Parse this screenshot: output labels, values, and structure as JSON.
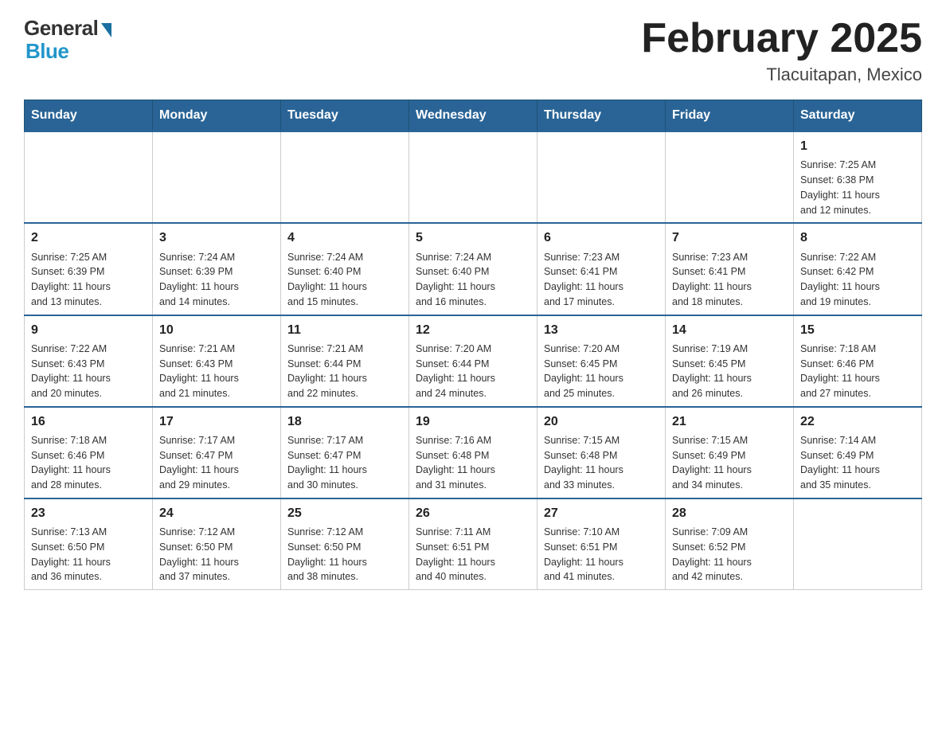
{
  "header": {
    "logo_general": "General",
    "logo_blue": "Blue",
    "month_title": "February 2025",
    "location": "Tlacuitapan, Mexico"
  },
  "days_of_week": [
    "Sunday",
    "Monday",
    "Tuesday",
    "Wednesday",
    "Thursday",
    "Friday",
    "Saturday"
  ],
  "weeks": [
    [
      {
        "day": "",
        "info": ""
      },
      {
        "day": "",
        "info": ""
      },
      {
        "day": "",
        "info": ""
      },
      {
        "day": "",
        "info": ""
      },
      {
        "day": "",
        "info": ""
      },
      {
        "day": "",
        "info": ""
      },
      {
        "day": "1",
        "info": "Sunrise: 7:25 AM\nSunset: 6:38 PM\nDaylight: 11 hours\nand 12 minutes."
      }
    ],
    [
      {
        "day": "2",
        "info": "Sunrise: 7:25 AM\nSunset: 6:39 PM\nDaylight: 11 hours\nand 13 minutes."
      },
      {
        "day": "3",
        "info": "Sunrise: 7:24 AM\nSunset: 6:39 PM\nDaylight: 11 hours\nand 14 minutes."
      },
      {
        "day": "4",
        "info": "Sunrise: 7:24 AM\nSunset: 6:40 PM\nDaylight: 11 hours\nand 15 minutes."
      },
      {
        "day": "5",
        "info": "Sunrise: 7:24 AM\nSunset: 6:40 PM\nDaylight: 11 hours\nand 16 minutes."
      },
      {
        "day": "6",
        "info": "Sunrise: 7:23 AM\nSunset: 6:41 PM\nDaylight: 11 hours\nand 17 minutes."
      },
      {
        "day": "7",
        "info": "Sunrise: 7:23 AM\nSunset: 6:41 PM\nDaylight: 11 hours\nand 18 minutes."
      },
      {
        "day": "8",
        "info": "Sunrise: 7:22 AM\nSunset: 6:42 PM\nDaylight: 11 hours\nand 19 minutes."
      }
    ],
    [
      {
        "day": "9",
        "info": "Sunrise: 7:22 AM\nSunset: 6:43 PM\nDaylight: 11 hours\nand 20 minutes."
      },
      {
        "day": "10",
        "info": "Sunrise: 7:21 AM\nSunset: 6:43 PM\nDaylight: 11 hours\nand 21 minutes."
      },
      {
        "day": "11",
        "info": "Sunrise: 7:21 AM\nSunset: 6:44 PM\nDaylight: 11 hours\nand 22 minutes."
      },
      {
        "day": "12",
        "info": "Sunrise: 7:20 AM\nSunset: 6:44 PM\nDaylight: 11 hours\nand 24 minutes."
      },
      {
        "day": "13",
        "info": "Sunrise: 7:20 AM\nSunset: 6:45 PM\nDaylight: 11 hours\nand 25 minutes."
      },
      {
        "day": "14",
        "info": "Sunrise: 7:19 AM\nSunset: 6:45 PM\nDaylight: 11 hours\nand 26 minutes."
      },
      {
        "day": "15",
        "info": "Sunrise: 7:18 AM\nSunset: 6:46 PM\nDaylight: 11 hours\nand 27 minutes."
      }
    ],
    [
      {
        "day": "16",
        "info": "Sunrise: 7:18 AM\nSunset: 6:46 PM\nDaylight: 11 hours\nand 28 minutes."
      },
      {
        "day": "17",
        "info": "Sunrise: 7:17 AM\nSunset: 6:47 PM\nDaylight: 11 hours\nand 29 minutes."
      },
      {
        "day": "18",
        "info": "Sunrise: 7:17 AM\nSunset: 6:47 PM\nDaylight: 11 hours\nand 30 minutes."
      },
      {
        "day": "19",
        "info": "Sunrise: 7:16 AM\nSunset: 6:48 PM\nDaylight: 11 hours\nand 31 minutes."
      },
      {
        "day": "20",
        "info": "Sunrise: 7:15 AM\nSunset: 6:48 PM\nDaylight: 11 hours\nand 33 minutes."
      },
      {
        "day": "21",
        "info": "Sunrise: 7:15 AM\nSunset: 6:49 PM\nDaylight: 11 hours\nand 34 minutes."
      },
      {
        "day": "22",
        "info": "Sunrise: 7:14 AM\nSunset: 6:49 PM\nDaylight: 11 hours\nand 35 minutes."
      }
    ],
    [
      {
        "day": "23",
        "info": "Sunrise: 7:13 AM\nSunset: 6:50 PM\nDaylight: 11 hours\nand 36 minutes."
      },
      {
        "day": "24",
        "info": "Sunrise: 7:12 AM\nSunset: 6:50 PM\nDaylight: 11 hours\nand 37 minutes."
      },
      {
        "day": "25",
        "info": "Sunrise: 7:12 AM\nSunset: 6:50 PM\nDaylight: 11 hours\nand 38 minutes."
      },
      {
        "day": "26",
        "info": "Sunrise: 7:11 AM\nSunset: 6:51 PM\nDaylight: 11 hours\nand 40 minutes."
      },
      {
        "day": "27",
        "info": "Sunrise: 7:10 AM\nSunset: 6:51 PM\nDaylight: 11 hours\nand 41 minutes."
      },
      {
        "day": "28",
        "info": "Sunrise: 7:09 AM\nSunset: 6:52 PM\nDaylight: 11 hours\nand 42 minutes."
      },
      {
        "day": "",
        "info": ""
      }
    ]
  ]
}
